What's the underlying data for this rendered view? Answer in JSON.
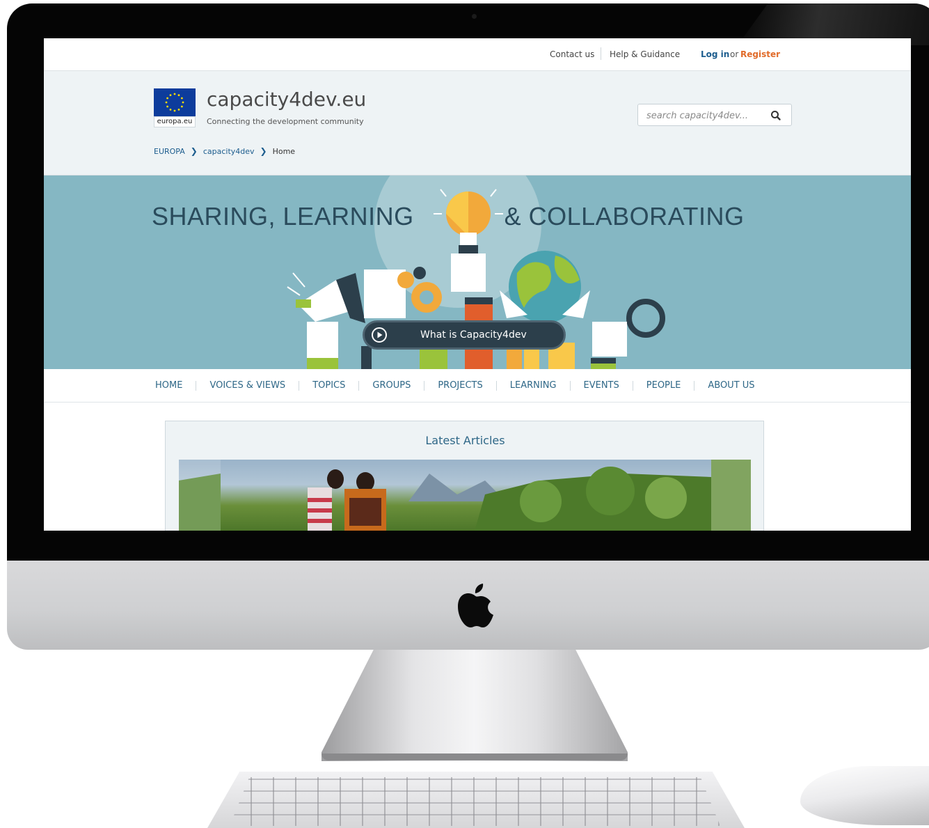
{
  "topbar": {
    "contact": "Contact us",
    "help": "Help & Guidance",
    "login": "Log in",
    "or": "or",
    "register": "Register"
  },
  "header": {
    "eu_label": "europa.eu",
    "site_title": "capacity4dev.eu",
    "tagline": "Connecting the development community",
    "search_placeholder": "search capacity4dev..."
  },
  "breadcrumb": [
    "EUROPA",
    "capacity4dev",
    "Home"
  ],
  "banner": {
    "title_left": "SHARING, LEARNING",
    "title_right": "& COLLABORATING",
    "video_button": "What is Capacity4dev"
  },
  "nav": [
    "HOME",
    "VOICES & VIEWS",
    "TOPICS",
    "GROUPS",
    "PROJECTS",
    "LEARNING",
    "EVENTS",
    "PEOPLE",
    "ABOUT US"
  ],
  "articles": {
    "title": "Latest Articles"
  },
  "colors": {
    "link_blue": "#1d5d8e",
    "register_orange": "#e16b2a",
    "banner_teal": "#85b7c3",
    "nav_text": "#2e6787",
    "eu_blue": "#0d3c9c"
  },
  "icons": [
    "eu-flag-icon",
    "search-icon",
    "chevron-right-icon",
    "play-icon",
    "lightbulb-icon",
    "megaphone-icon",
    "gears-icon",
    "globe-icon",
    "magnifier-icon",
    "apple-logo-icon"
  ]
}
